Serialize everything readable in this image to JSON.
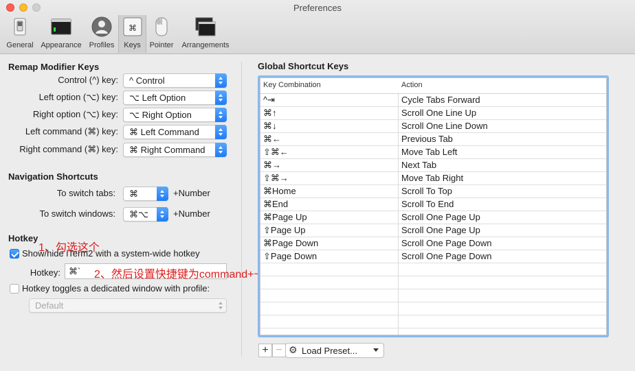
{
  "window": {
    "title": "Preferences"
  },
  "toolbar": {
    "items": [
      {
        "label": "General",
        "icon": "switch-icon"
      },
      {
        "label": "Appearance",
        "icon": "monitor-icon"
      },
      {
        "label": "Profiles",
        "icon": "person-icon"
      },
      {
        "label": "Keys",
        "icon": "command-key-icon",
        "selected": true
      },
      {
        "label": "Pointer",
        "icon": "mouse-icon"
      },
      {
        "label": "Arrangements",
        "icon": "windows-icon"
      }
    ]
  },
  "remap": {
    "title": "Remap Modifier Keys",
    "rows": [
      {
        "label": "Control (^) key:",
        "value": "^ Control"
      },
      {
        "label": "Left option (⌥) key:",
        "value": "⌥ Left Option"
      },
      {
        "label": "Right option (⌥) key:",
        "value": "⌥ Right Option"
      },
      {
        "label": "Left command (⌘) key:",
        "value": "⌘ Left Command"
      },
      {
        "label": "Right command (⌘) key:",
        "value": "⌘ Right Command"
      }
    ]
  },
  "navigation": {
    "title": "Navigation Shortcuts",
    "rows": [
      {
        "label": "To switch tabs:",
        "value": "⌘",
        "suffix": "+Number"
      },
      {
        "label": "To switch windows:",
        "value": "⌘⌥",
        "suffix": "+Number"
      }
    ]
  },
  "hotkey": {
    "title": "Hotkey",
    "show_hide_label": "Show/hide iTerm2 with a system-wide hotkey",
    "show_hide_checked": true,
    "hotkey_label": "Hotkey:",
    "hotkey_value": "⌘`",
    "dedicated_label": "Hotkey toggles a dedicated window with profile:",
    "dedicated_checked": false,
    "profile_value": "Default"
  },
  "annotations": {
    "step1": "1、勾选这个",
    "step2": "2、然后设置快捷键为command+~"
  },
  "global": {
    "title": "Global Shortcut Keys",
    "columns": [
      "Key Combination",
      "Action"
    ],
    "rows": [
      {
        "key": "^⇥",
        "action": "Cycle Tabs Forward"
      },
      {
        "key": "⌘↑",
        "action": "Scroll One Line Up"
      },
      {
        "key": "⌘↓",
        "action": "Scroll One Line Down"
      },
      {
        "key": "⌘←",
        "action": "Previous Tab"
      },
      {
        "key": "⇧⌘←",
        "action": "Move Tab Left"
      },
      {
        "key": "⌘→",
        "action": "Next Tab"
      },
      {
        "key": "⇧⌘→",
        "action": "Move Tab Right"
      },
      {
        "key": "⌘Home",
        "action": "Scroll To Top"
      },
      {
        "key": "⌘End",
        "action": "Scroll To End"
      },
      {
        "key": "⌘Page Up",
        "action": "Scroll One Page Up"
      },
      {
        "key": "⇧Page Up",
        "action": "Scroll One Page Up"
      },
      {
        "key": "⌘Page Down",
        "action": "Scroll One Page Down"
      },
      {
        "key": "⇧Page Down",
        "action": "Scroll One Page Down"
      }
    ],
    "add_label": "+",
    "remove_label": "−",
    "load_preset_label": "Load Preset..."
  }
}
